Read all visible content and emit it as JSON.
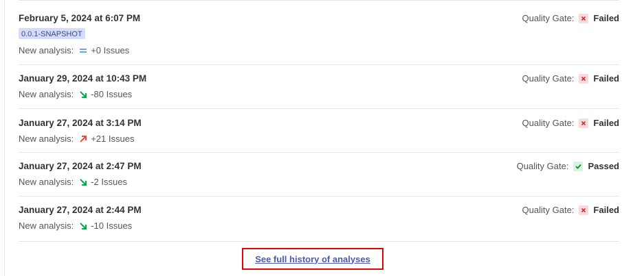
{
  "analyses": [
    {
      "date": "February 5, 2024 at 6:07 PM",
      "version": "0.0.1-SNAPSHOT",
      "issues_label": "New analysis:",
      "trend": "equal-icon",
      "issues": "+0 Issues",
      "qg_label": "Quality Gate:",
      "qg_status": "Failed",
      "qg_icon": "x-icon"
    },
    {
      "date": "January 29, 2024 at 10:43 PM",
      "issues_label": "New analysis:",
      "trend": "arrow-down-right-icon",
      "issues": "-80 Issues",
      "qg_label": "Quality Gate:",
      "qg_status": "Failed",
      "qg_icon": "x-icon"
    },
    {
      "date": "January 27, 2024 at 3:14 PM",
      "issues_label": "New analysis:",
      "trend": "arrow-up-right-icon",
      "issues": "+21 Issues",
      "qg_label": "Quality Gate:",
      "qg_status": "Failed",
      "qg_icon": "x-icon"
    },
    {
      "date": "January 27, 2024 at 2:47 PM",
      "issues_label": "New analysis:",
      "trend": "arrow-down-right-icon",
      "issues": "-2 Issues",
      "qg_label": "Quality Gate:",
      "qg_status": "Passed",
      "qg_icon": "check-icon"
    },
    {
      "date": "January 27, 2024 at 2:44 PM",
      "issues_label": "New analysis:",
      "trend": "arrow-down-right-icon",
      "issues": "-10 Issues",
      "qg_label": "Quality Gate:",
      "qg_status": "Failed",
      "qg_icon": "x-icon"
    }
  ],
  "history_link": "See full history of analyses",
  "colors": {
    "failed": "#d02f3a",
    "passed": "#008a25",
    "trend_down": "#00a84f",
    "trend_up": "#e84b3c",
    "trend_equal": "#4aa3df",
    "link": "#4b5ab0",
    "highlight_border": "#e60000"
  }
}
